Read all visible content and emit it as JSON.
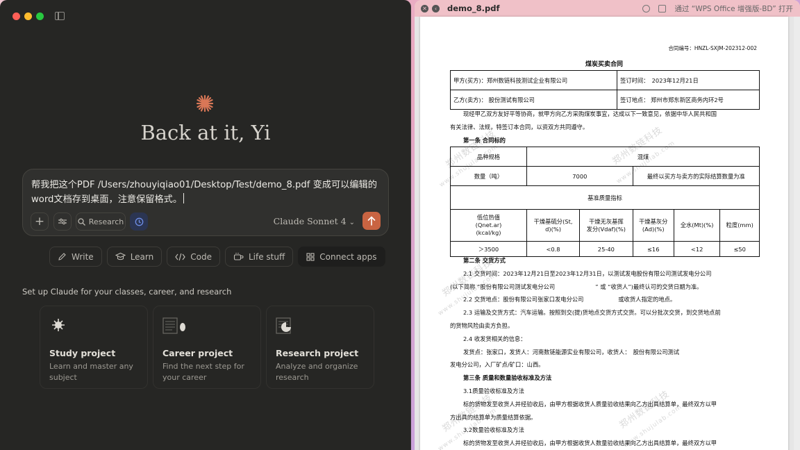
{
  "claude": {
    "greeting": "Back at it, Yi",
    "composer_text": "帮我把这个PDF /Users/zhouyiqiao01/Desktop/Test/demo_8.pdf 变成可以编辑的word文档存到桌面，注意保留格式。",
    "research_label": "Research",
    "model": "Claude Sonnet 4",
    "model_chevron": "⌄",
    "actions": [
      "Write",
      "Learn",
      "Code",
      "Life stuff",
      "Connect apps"
    ],
    "setup_title": "Set up Claude for your classes, career, and research",
    "cards": [
      {
        "title": "Study project",
        "desc": "Learn and master any subject"
      },
      {
        "title": "Career project",
        "desc": "Find the next step for your career"
      },
      {
        "title": "Research project",
        "desc": "Analyze and organize research"
      }
    ],
    "accent": "#c96442"
  },
  "preview": {
    "filename": "demo_8.pdf",
    "open_with": "通过 “WPS Office 增强版-BD” 打开",
    "watermark": "郑州数链科技",
    "watermark_url": "www.shujulab.com",
    "doc": {
      "contract_no": "合同编号：HNZL-SXJM-202312-002",
      "title": "煤炭买卖合同",
      "party_a": "甲方(买方)：郑州数链科技测试企业有限公司",
      "sign_time": "签订时间：　2023年12月21日",
      "party_b": "乙方(卖方)：  股份测试有限公司",
      "sign_place": "签订地点：  郑州市郑东新区商务内环2号",
      "intro1": "现经甲乙双方友好平等协商，就甲方向乙方采购煤炭事宜，达成以下一致意见，依据中华人民共和国",
      "intro2": "有关法律、法规，特签订本合同，以资双方共同遵守。",
      "art1": "第一条 合同标的",
      "t_spec": "品种规格",
      "t_coal": "混煤",
      "t_qty_label": "数量（吨）",
      "t_qty": "7000",
      "t_qty_note": "最终以买方与卖方的实际结算数量为准",
      "t_quality": "基准质量指标",
      "t_headers": [
        "低位热值\n(Qnet.ar)\n(kcal/kg)",
        "干燥基硫分(St,\nd)(%)",
        "干燥无灰基挥\n发分(Vdaf)(%)",
        "干燥基灰分\n(Ad)(%)",
        "全水(Mt)(%)",
        "粒度(mm)"
      ],
      "t_values": [
        "＞3500",
        "<0.8",
        "25-40",
        "≤16",
        "<12",
        "≤50"
      ],
      "art2": "第二条 交货方式",
      "p21a": "2.1 交货时间：2023年12月21日至2023年12月31日，以测试发电股份有限公司测试发电分公司",
      "p21b": "(以下简称 “股份有限公司测试发电分公司　　　　　　　” 或 “收货人”)最终认可的交货日期为准。",
      "p22": "2.2 交货地点：股份有限公司张家口发电分公司　　　　　　或收货人指定的地点。",
      "p23a": "2.3 运输及交货方式：汽车运输。按照到交(提)货地点交货方式交货。可以分批次交货，到交货地点前",
      "p23b": "的货物风险由卖方负担。",
      "p24": "2.4 收发货相关的信息：",
      "p24a": "发货点：张家口，发货人：河南数链能源实业有限公司，收货人：　股份有限公司测试",
      "p24b": "发电分公司，入厂矿点/矿口：山西。",
      "art3": "第三条 质量和数量验收标准及方法",
      "p31": "3.1质量验收标准及方法",
      "p31a": "标的货物发至收货人并经验收后，由甲方根据收货人质量验收结果向乙方出具结算单，最终双方以甲",
      "p31b": "方出具的结算单为质量结算依据。",
      "p32": "3.2数量验收标准及方法",
      "p32a": "标的货物发至收货人并经验收后，由甲方根据收货人数量验收结果向乙方出具结算单，最终双方以甲"
    }
  }
}
